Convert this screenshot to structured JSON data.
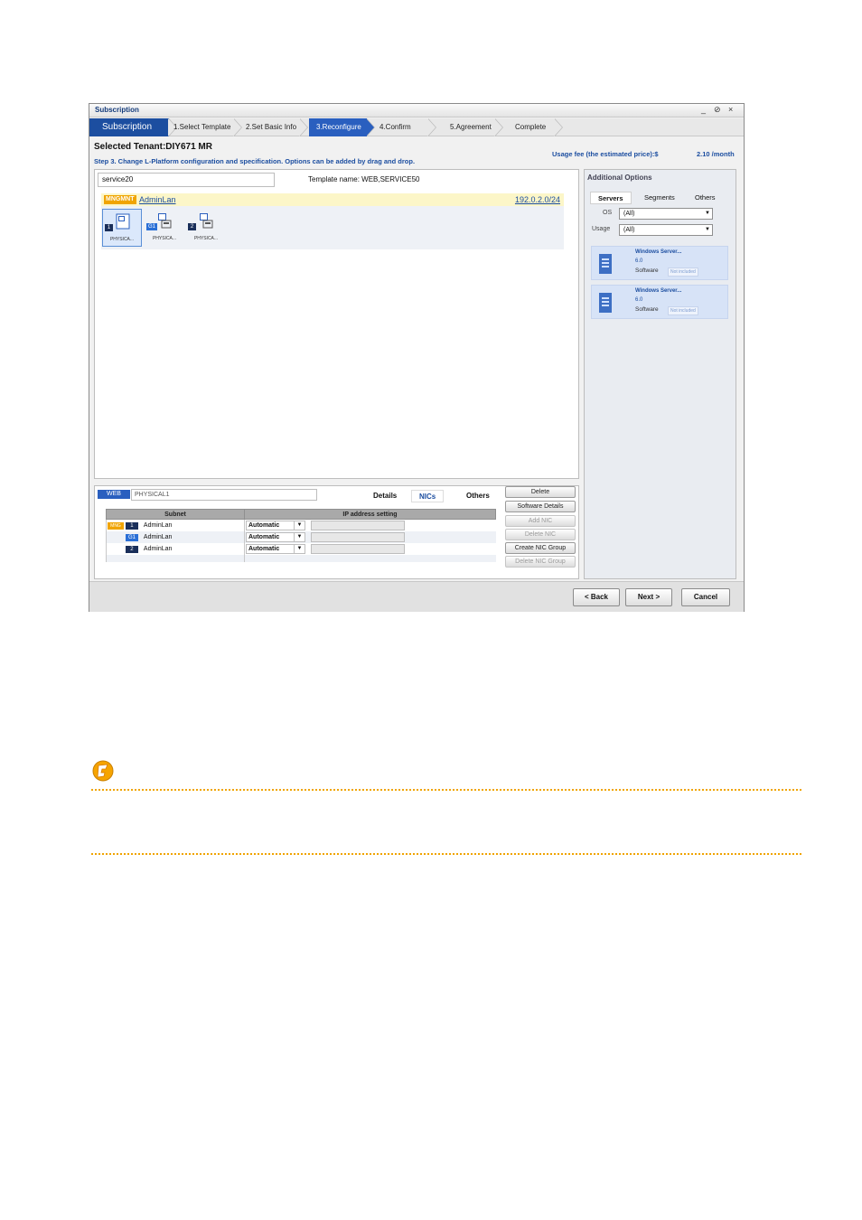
{
  "window": {
    "title": "Subscription",
    "controls": [
      "_",
      "⊘",
      "×"
    ]
  },
  "steps": {
    "head": "Subscription",
    "items": [
      "1.Select Template",
      "2.Set Basic Info",
      "3.Reconfigure",
      "4.Confirm",
      "5.Agreement",
      "Complete"
    ],
    "active_index": 2
  },
  "header": {
    "tenant": "Selected Tenant:DIY671 MR",
    "step_desc": "Step 3. Change L-Platform configuration and specification. Options can be added by drag and drop.",
    "usage_label": "Usage fee (the estimated price):$",
    "usage_value": "2.10 /month"
  },
  "canvas": {
    "service_name": "service20",
    "template_name": "Template name: WEB,SERVICE50",
    "segment": {
      "tag": "MNGMNT",
      "name": "AdminLan",
      "address": "192.0.2.0/24"
    },
    "servers": [
      {
        "label": "PHYSICA...",
        "badge": "1"
      },
      {
        "label": "PHYSICA...",
        "badge": "G1"
      },
      {
        "label": "PHYSICA...",
        "badge": "2"
      }
    ]
  },
  "detail": {
    "tag": "WEB",
    "server_name": "PHYSICAL1",
    "tabs": [
      "Details",
      "NICs",
      "Others"
    ],
    "active_tab": "NICs",
    "columns": [
      "Subnet",
      "IP address setting"
    ],
    "rows": [
      {
        "mng": "MNG",
        "nic": "1",
        "subnet": "AdminLan",
        "setting": "Automatic"
      },
      {
        "mng": "",
        "nic": "G1",
        "subnet": "AdminLan",
        "setting": "Automatic"
      },
      {
        "mng": "",
        "nic": "2",
        "subnet": "AdminLan",
        "setting": "Automatic"
      }
    ],
    "arrow": "▼",
    "buttons": [
      "Delete",
      "Software Details",
      "Add NIC",
      "Delete NIC",
      "Create NIC Group",
      "Delete NIC Group"
    ]
  },
  "options": {
    "title": "Additional Options",
    "tabs": [
      "Servers",
      "Segments",
      "Others"
    ],
    "os_label": "OS",
    "os_value": "(All)",
    "usage_label": "Usage",
    "usage_value": "(All)",
    "arrow": "▼",
    "cards": [
      {
        "name": "Windows Server...",
        "version": "6.0",
        "software": "Software",
        "status": "Not included"
      },
      {
        "name": "Windows Server...",
        "version": "6.0",
        "software": "Software",
        "status": "Not included"
      }
    ]
  },
  "footer": {
    "back": "< Back",
    "next": "Next >",
    "cancel": "Cancel"
  },
  "colors": {
    "accent": "#1c4ea0",
    "step_active": "#2a5fbf",
    "mng_tag": "#f0a400",
    "note_dots": "#f0a400"
  },
  "note": {
    "icon": "caution-icon"
  }
}
